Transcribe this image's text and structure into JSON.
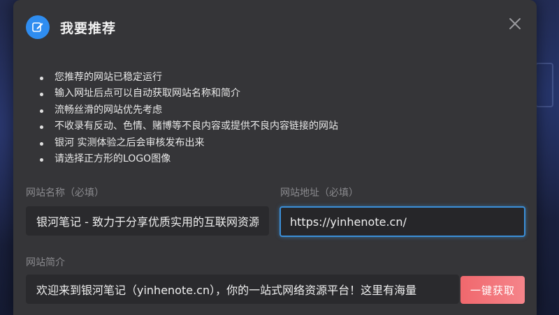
{
  "modal": {
    "title": "我要推荐",
    "icon": "edit-icon",
    "close_icon": "close-icon",
    "accent": "#2f8df0"
  },
  "notes": [
    "您推荐的网站已稳定运行",
    "输入网址后点可以自动获取网站名称和简介",
    "流畅丝滑的网站优先考虑",
    "不收录有反动、色情、赌博等不良内容或提供不良内容链接的网站",
    "银河 实测体验之后会审核发布出来",
    "请选择正方形的LOGO图像"
  ],
  "form": {
    "site_name_label": "网站名称（必填）",
    "site_name_value": "银河笔记 - 致力于分享优质实用的互联网资源",
    "site_url_label": "网站地址（必填）",
    "site_url_value": "https://yinhenote.cn/",
    "site_desc_label": "网站简介",
    "site_desc_value": "欢迎来到银河笔记（yinhenote.cn），你的一站式网络资源平台！这里有海量",
    "fetch_button": "一键获取",
    "focus_color": "#3b8fd8",
    "button_color": "#f0686d"
  }
}
